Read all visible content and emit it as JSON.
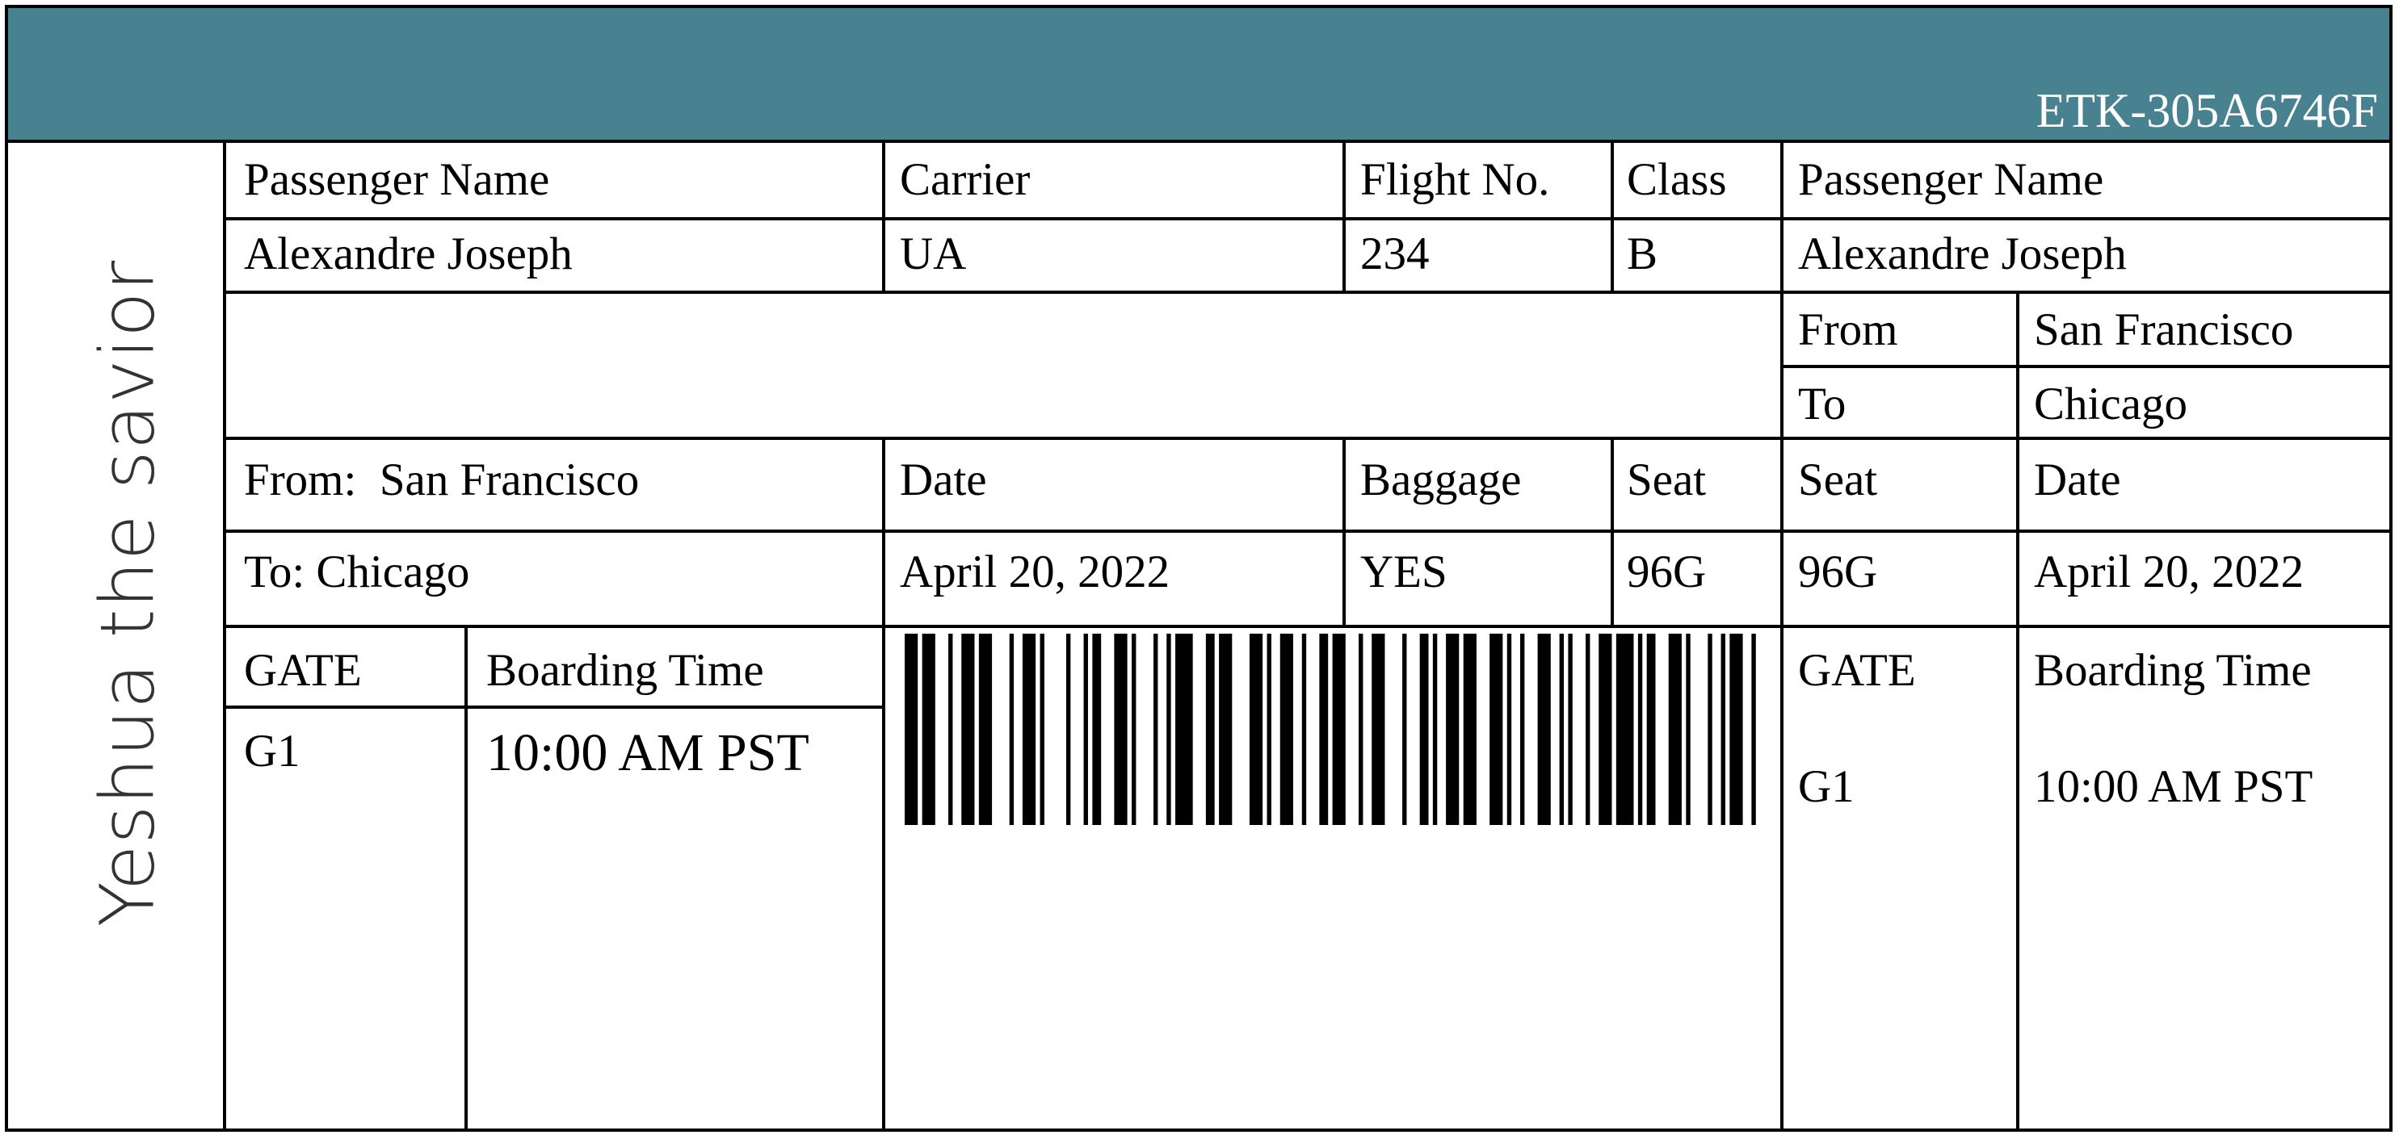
{
  "header": {
    "ticket_code": "ETK-305A6746F",
    "color": "#48818f"
  },
  "brand": {
    "text": "Yeshua the savior"
  },
  "main": {
    "passenger_name_label": "Passenger Name",
    "passenger_name": "Alexandre Joseph",
    "carrier_label": "Carrier",
    "carrier": "UA",
    "flight_label": "Flight No.",
    "flight": "234",
    "class_label": "Class",
    "class": "B",
    "from_text": "From:  San Francisco",
    "to_text": "To: Chicago",
    "date_label": "Date",
    "date": "April 20, 2022",
    "baggage_label": "Baggage",
    "baggage": "YES",
    "seat_label": "Seat",
    "seat": "96G",
    "gate_label": "GATE",
    "gate": "G1",
    "boarding_label": "Boarding Time",
    "boarding": "10:00 AM PST"
  },
  "stub": {
    "passenger_name_label": "Passenger Name",
    "passenger_name": "Alexandre Joseph",
    "from_label": "From",
    "from": "San Francisco",
    "to_label": "To",
    "to": "Chicago",
    "seat_label": "Seat",
    "seat": "96G",
    "date_label": "Date",
    "date": "April 20, 2022",
    "gate_label": "GATE",
    "gate": "G1",
    "boarding_label": "Boarding Time",
    "boarding": "10:00 AM PST"
  },
  "barcode": {
    "bars": [
      3,
      1,
      3,
      3,
      1,
      2,
      3,
      1,
      3,
      4,
      1,
      2,
      3,
      1,
      1,
      5,
      1,
      3,
      1,
      1,
      2,
      3,
      3,
      1,
      1,
      4,
      1,
      2,
      1,
      1,
      4,
      3,
      2,
      1,
      3,
      4,
      3,
      1,
      1,
      2,
      3,
      2,
      1,
      3,
      2,
      1,
      3,
      3,
      1,
      2,
      3,
      4,
      1,
      3,
      2,
      1,
      1,
      2,
      3,
      1,
      3,
      3,
      3,
      1,
      1,
      2,
      1,
      3,
      3,
      2,
      1,
      1,
      1,
      3,
      1,
      2,
      3,
      1,
      4,
      1,
      1,
      1,
      2,
      3,
      3,
      1,
      1,
      4,
      1,
      2,
      1,
      1,
      3,
      2,
      1,
      3
    ]
  }
}
